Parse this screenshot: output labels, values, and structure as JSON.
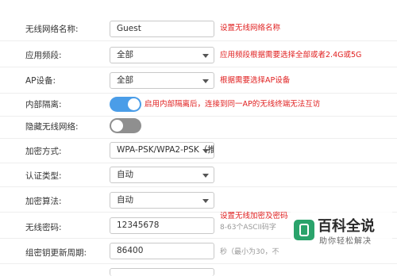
{
  "rows": {
    "ssid": {
      "label": "无线网络名称:",
      "value": "Guest",
      "note": "设置无线网络名称"
    },
    "band": {
      "label": "应用频段:",
      "value": "全部",
      "note": "应用频段根据需要选择全部或者2.4G或5G"
    },
    "ap": {
      "label": "AP设备:",
      "value": "全部",
      "note": "根据需要选择AP设备"
    },
    "isolation": {
      "label": "内部隔离:",
      "state": "on",
      "note": "启用内部隔离后，连接到同一AP的无线终端无法互访"
    },
    "hide": {
      "label": "隐藏无线网络:",
      "state": "off"
    },
    "encryption": {
      "label": "加密方式:",
      "value": "WPA-PSK/WPA2-PSK（推"
    },
    "auth": {
      "label": "认证类型:",
      "value": "自动"
    },
    "algorithm": {
      "label": "加密算法:",
      "value": "自动"
    },
    "password": {
      "label": "无线密码:",
      "value": "12345678",
      "note": "设置无线加密及密码",
      "hint": "8-63个ASCII码字"
    },
    "rekey": {
      "label": "组密钥更新周期:",
      "value": "86400",
      "hint": "秒（最小为30，不"
    }
  },
  "watermark": {
    "title": "百科全说",
    "subtitle": "助你轻松解决"
  },
  "colors": {
    "accent": "#4a9de8",
    "note_red": "#e02020",
    "toggle_off": "#8f8f8f"
  }
}
